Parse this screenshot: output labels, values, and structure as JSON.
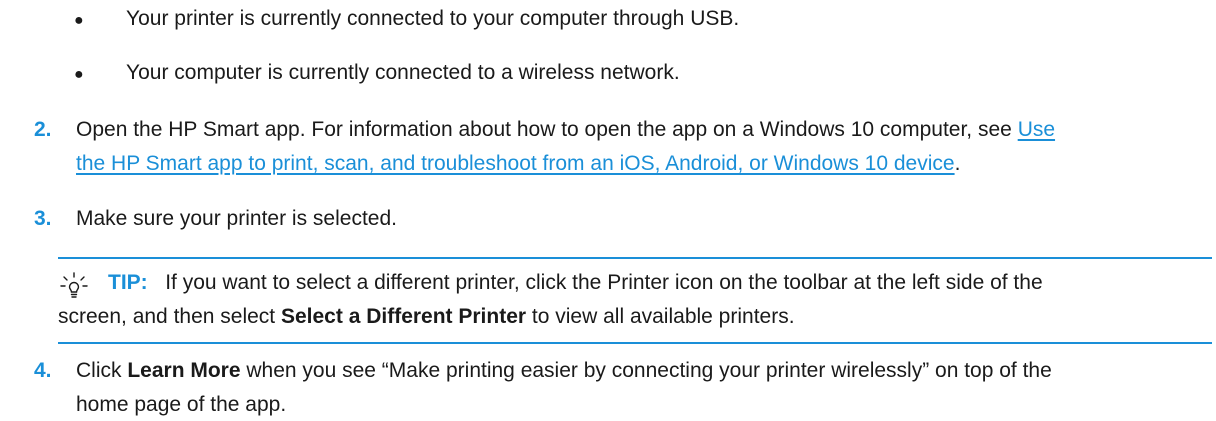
{
  "bullets": [
    "Your printer is currently connected to your computer through USB.",
    "Your computer is currently connected to a wireless network."
  ],
  "bullet_glyph": "●",
  "steps": [
    {
      "number": "2.",
      "text_before": "Open the HP Smart app. For information about how to open the app on a Windows 10 computer, see",
      "link_part1": "Use",
      "link_part2": "the HP Smart app to print, scan, and troubleshoot from an iOS, Android, or Windows 10 device",
      "text_after": "."
    },
    {
      "number": "3.",
      "text": "Make sure your printer is selected."
    },
    {
      "number": "4.",
      "text_before": "Click ",
      "bold": "Learn More",
      "text_after_line1": " when you see “Make printing easier by connecting your printer wirelessly” on top of the",
      "line2": "home page of the app."
    }
  ],
  "tip": {
    "icon": "lightbulb-icon",
    "label": "TIP:",
    "text_line1": "If you want to select a different printer, click the Printer icon on the toolbar at the left side of the",
    "line2_before": "screen, and then select ",
    "line2_bold": "Select a Different Printer",
    "line2_after": " to view all available printers."
  },
  "colors": {
    "accent": "#1a8fd8",
    "text": "#1a1a1a"
  }
}
